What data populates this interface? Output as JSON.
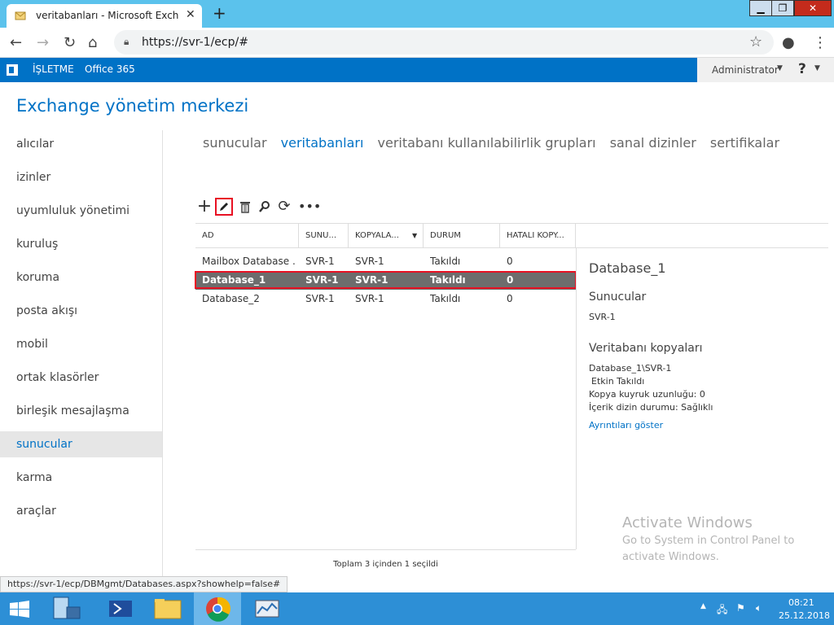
{
  "browser": {
    "tab_title": "veritabanları - Microsoft Exchang",
    "tab_close": "✕",
    "new_tab": "+",
    "url": "https://svr-1/ecp/#",
    "status_url": "https://svr-1/ecp/DBMgmt/Databases.aspx?showhelp=false#"
  },
  "topnav": {
    "isletme": "İŞLETME",
    "office": "Office 365",
    "user": "Administrator",
    "help": "?"
  },
  "app_title": "Exchange yönetim merkezi",
  "sidebar": {
    "items": [
      {
        "label": "alıcılar"
      },
      {
        "label": "izinler"
      },
      {
        "label": "uyumluluk yönetimi"
      },
      {
        "label": "kuruluş"
      },
      {
        "label": "koruma"
      },
      {
        "label": "posta akışı"
      },
      {
        "label": "mobil"
      },
      {
        "label": "ortak klasörler"
      },
      {
        "label": "birleşik mesajlaşma"
      },
      {
        "label": "sunucular"
      },
      {
        "label": "karma"
      },
      {
        "label": "araçlar"
      }
    ]
  },
  "tabs": [
    {
      "label": "sunucular"
    },
    {
      "label": "veritabanları"
    },
    {
      "label": "veritabanı kullanılabilirlik grupları"
    },
    {
      "label": "sanal dizinler"
    },
    {
      "label": "sertifikalar"
    }
  ],
  "grid": {
    "columns": [
      "AD",
      "SUNU...",
      "KOPYALA...",
      "DURUM",
      "HATALI KOPY..."
    ],
    "rows": [
      {
        "name": "Mailbox Database ...",
        "server": "SVR-1",
        "copies": "SVR-1",
        "status": "Takıldı",
        "bad": "0"
      },
      {
        "name": "Database_1",
        "server": "SVR-1",
        "copies": "SVR-1",
        "status": "Takıldı",
        "bad": "0"
      },
      {
        "name": "Database_2",
        "server": "SVR-1",
        "copies": "SVR-1",
        "status": "Takıldı",
        "bad": "0"
      }
    ],
    "status": "Toplam 3 içinden 1 seçildi"
  },
  "details": {
    "title": "Database_1",
    "servers_heading": "Sunucular",
    "server": "SVR-1",
    "copies_heading": "Veritabanı kopyaları",
    "copy_name": "Database_1\\SVR-1",
    "copy_state": "Etkin Takıldı",
    "queue": "Kopya kuyruk uzunluğu: 0",
    "index": "İçerik dizin durumu: Sağlıklı",
    "link": "Ayrıntıları göster"
  },
  "watermark": {
    "line1": "Activate Windows",
    "line2": "Go to System in Control Panel to",
    "line3": "activate Windows."
  },
  "clock": {
    "time": "08:21",
    "date": "25.12.2018"
  }
}
